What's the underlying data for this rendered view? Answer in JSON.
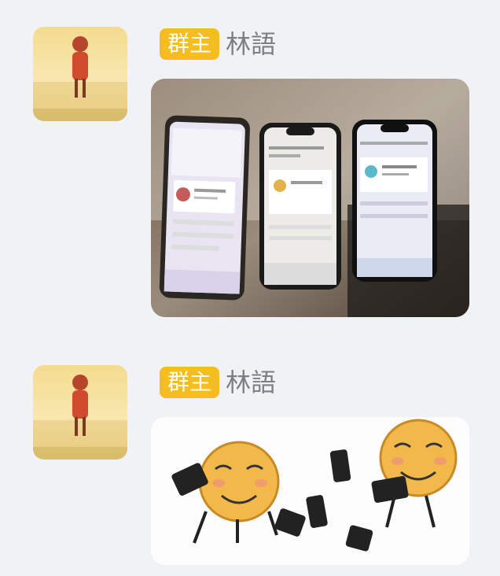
{
  "messages": [
    {
      "sender_badge": "群主",
      "sender_name": "林語",
      "content_type": "photo",
      "photo_subject": "three-phones-on-table"
    },
    {
      "sender_badge": "群主",
      "sender_name": "林語",
      "content_type": "sticker",
      "sticker_subject": "laughing-emoji-drinking"
    }
  ],
  "colors": {
    "page_bg": "#f1f2f6",
    "badge_bg": "#f5bd1f",
    "name_text": "#7b7f86"
  }
}
